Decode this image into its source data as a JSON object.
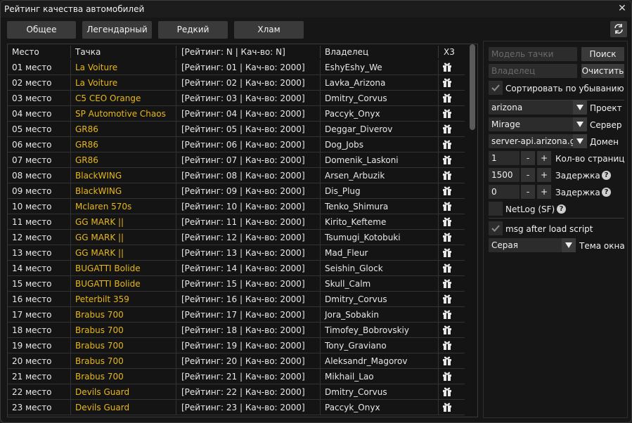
{
  "window": {
    "title": "Рейтинг качества автомобилей",
    "close_label": "✕"
  },
  "tabs": [
    {
      "label": "Общее"
    },
    {
      "label": "Легендарный"
    },
    {
      "label": "Редкий"
    },
    {
      "label": "Хлам"
    }
  ],
  "table": {
    "headers": {
      "place": "Место",
      "car": "Тачка",
      "rating": "[Рейтинг: N | Кач-во: N]",
      "owner": "Владелец",
      "x3": "Х3"
    },
    "rows": [
      {
        "place": "01 место",
        "car": "La Voiture",
        "rating": "[Рейтинг: 01 | Кач-во: 2000]",
        "owner": "EshyEshy_We"
      },
      {
        "place": "02 место",
        "car": "La Voiture",
        "rating": "[Рейтинг: 02 | Кач-во: 2000]",
        "owner": "Lavka_Arizona"
      },
      {
        "place": "03 место",
        "car": "C5 CEO Orange",
        "rating": "[Рейтинг: 03 | Кач-во: 2000]",
        "owner": "Dmitry_Corvus"
      },
      {
        "place": "04 место",
        "car": "SP Automotive Chaos",
        "rating": "[Рейтинг: 04 | Кач-во: 2000]",
        "owner": "Paccyk_Onyx"
      },
      {
        "place": "05 место",
        "car": "GR86",
        "rating": "[Рейтинг: 05 | Кач-во: 2000]",
        "owner": "Deggar_Diverov"
      },
      {
        "place": "06 место",
        "car": "GR86",
        "rating": "[Рейтинг: 06 | Кач-во: 2000]",
        "owner": "Dog_Jobs"
      },
      {
        "place": "07 место",
        "car": "GR86",
        "rating": "[Рейтинг: 07 | Кач-во: 2000]",
        "owner": "Domenik_Laskoni"
      },
      {
        "place": "08 место",
        "car": "BlackWING",
        "rating": "[Рейтинг: 08 | Кач-во: 2000]",
        "owner": "Arsen_Arbuzik"
      },
      {
        "place": "09 место",
        "car": "BlackWING",
        "rating": "[Рейтинг: 09 | Кач-во: 2000]",
        "owner": "Dis_Plug"
      },
      {
        "place": "10 место",
        "car": "Mclaren 570s",
        "rating": "[Рейтинг: 10 | Кач-во: 2000]",
        "owner": "Tenko_Shimura"
      },
      {
        "place": "11 место",
        "car": "GG MARK ||",
        "rating": "[Рейтинг: 11 | Кач-во: 2000]",
        "owner": "Kirito_Kefteme"
      },
      {
        "place": "12 место",
        "car": "GG MARK ||",
        "rating": "[Рейтинг: 12 | Кач-во: 2000]",
        "owner": "Tsumugi_Kotobuki"
      },
      {
        "place": "13 место",
        "car": "GG MARK ||",
        "rating": "[Рейтинг: 13 | Кач-во: 2000]",
        "owner": "Mad_Fleur"
      },
      {
        "place": "14 место",
        "car": "BUGATTI Bolide",
        "rating": "[Рейтинг: 14 | Кач-во: 2000]",
        "owner": "Seishin_Glock"
      },
      {
        "place": "15 место",
        "car": "BUGATTI Bolide",
        "rating": "[Рейтинг: 15 | Кач-во: 2000]",
        "owner": "Skull_Calm"
      },
      {
        "place": "16 место",
        "car": "Peterbilt 359",
        "rating": "[Рейтинг: 16 | Кач-во: 2000]",
        "owner": "Dmitry_Corvus"
      },
      {
        "place": "17 место",
        "car": "Brabus 700",
        "rating": "[Рейтинг: 17 | Кач-во: 2000]",
        "owner": "Jora_Sobakin"
      },
      {
        "place": "18 место",
        "car": "Brabus 700",
        "rating": "[Рейтинг: 18 | Кач-во: 2000]",
        "owner": "Timofey_Bobrovskiy"
      },
      {
        "place": "19 место",
        "car": "Brabus 700",
        "rating": "[Рейтинг: 19 | Кач-во: 2000]",
        "owner": "Tony_Graviano"
      },
      {
        "place": "20 место",
        "car": "Brabus 700",
        "rating": "[Рейтинг: 20 | Кач-во: 2000]",
        "owner": "Aleksandr_Magorov"
      },
      {
        "place": "21 место",
        "car": "Brabus 700",
        "rating": "[Рейтинг: 21 | Кач-во: 2000]",
        "owner": "Mikhail_Lao"
      },
      {
        "place": "22 место",
        "car": "Devils Guard",
        "rating": "[Рейтинг: 22 | Кач-во: 2000]",
        "owner": "Dmitry_Corvus"
      },
      {
        "place": "23 место",
        "car": "Devils Guard",
        "rating": "[Рейтинг: 23 | Кач-во: 2000]",
        "owner": "Paccyk_Onyx"
      }
    ],
    "row_icon": "gift-icon"
  },
  "panel": {
    "model_placeholder": "Модель тачки",
    "search_label": "Поиск",
    "owner_placeholder": "Владелец",
    "clear_label": "Очистить",
    "sort_desc_label": "Сортировать по убыванию",
    "project_value": "arizona",
    "project_label": "Проект",
    "server_value": "Mirage",
    "server_label": "Сервер",
    "domain_value": "server-api.arizona.games",
    "domain_label": "Домен",
    "pages_value": "1",
    "pages_label": "Кол-во страниц",
    "delay1_value": "1500",
    "delay1_label": "Задержка",
    "delay2_value": "0",
    "delay2_label": "Задержка",
    "netlog_label": "NetLog (SF)",
    "msg_label": "msg after load script",
    "theme_value": "Серая",
    "theme_label": "Тема окна",
    "minus": "-",
    "plus": "+",
    "help": "?"
  },
  "colors": {
    "accent_car": "#e8b818",
    "bg": "#161616",
    "button": "#3a3a3a"
  }
}
